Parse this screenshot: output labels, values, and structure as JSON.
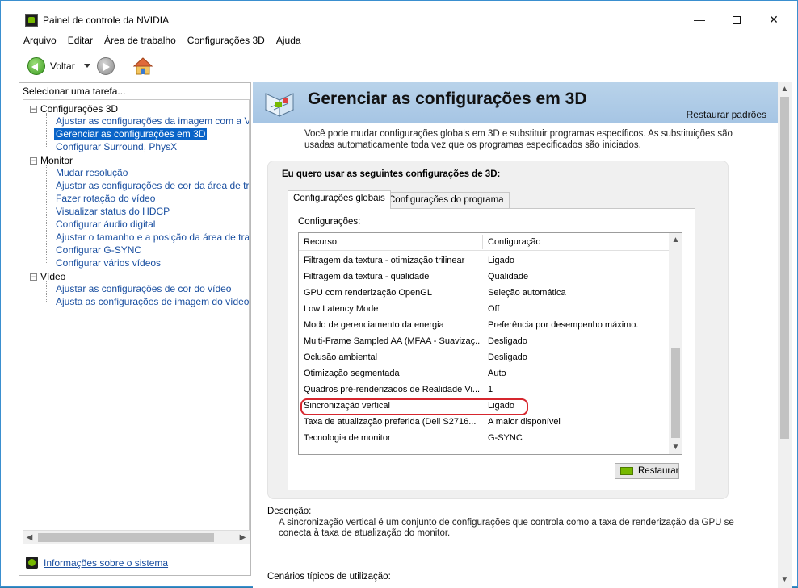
{
  "window": {
    "title": "Painel de controle da NVIDIA",
    "minimize_glyph": "—",
    "close_glyph": "✕"
  },
  "menu": [
    "Arquivo",
    "Editar",
    "Área de trabalho",
    "Configurações 3D",
    "Ajuda"
  ],
  "toolbar": {
    "back_label": "Voltar"
  },
  "left": {
    "header": "Selecionar uma tarefa...",
    "groups": [
      {
        "label": "Configurações 3D",
        "expander": "−",
        "items": [
          "Ajustar as configurações da imagem com a Visuali:",
          "Gerenciar as configurações em 3D",
          "Configurar Surround, PhysX"
        ]
      },
      {
        "label": "Monitor",
        "expander": "−",
        "items": [
          "Mudar resolução",
          "Ajustar as configurações de cor da área de trabal",
          "Fazer rotação do vídeo",
          "Visualizar status do HDCP",
          "Configurar áudio digital",
          "Ajustar o tamanho e a posição da área de trabalh",
          "Configurar G-SYNC",
          "Configurar vários vídeos"
        ]
      },
      {
        "label": "Vídeo",
        "expander": "−",
        "items": [
          "Ajustar as configurações de cor do vídeo",
          "Ajusta as configurações de imagem do vídeo"
        ]
      }
    ],
    "selected_item": "Gerenciar as configurações em 3D",
    "system_info": "Informações sobre o sistema"
  },
  "main": {
    "title": "Gerenciar as configurações em 3D",
    "restore_defaults": "Restaurar padrões",
    "intro": "Você pode mudar configurações globais em 3D e substituir programas específicos. As substituições são usadas automaticamente toda vez que os programas especificados são iniciados.",
    "group_title": "Eu quero usar as seguintes configurações de 3D:",
    "tabs": [
      "Configurações globais",
      "Configurações do programa"
    ],
    "active_tab": "Configurações globais",
    "settings_label": "Configurações:",
    "columns": [
      "Recurso",
      "Configuração"
    ],
    "rows": [
      [
        "Filtragem da textura - otimização trilinear",
        "Ligado"
      ],
      [
        "Filtragem da textura - qualidade",
        "Qualidade"
      ],
      [
        "GPU com renderização OpenGL",
        "Seleção automática"
      ],
      [
        "Low Latency Mode",
        "Off"
      ],
      [
        "Modo de gerenciamento da energia",
        "Preferência por desempenho máximo."
      ],
      [
        "Multi-Frame Sampled AA (MFAA - Suavizaç...",
        "Desligado"
      ],
      [
        "Oclusão ambiental",
        "Desligado"
      ],
      [
        "Otimização segmentada",
        "Auto"
      ],
      [
        "Quadros pré-renderizados de Realidade Vi...",
        "1"
      ],
      [
        "Sincronização vertical",
        "Ligado"
      ],
      [
        "Taxa de atualização preferida (Dell S2716...",
        "A maior disponível"
      ],
      [
        "Tecnologia de monitor",
        "G-SYNC"
      ]
    ],
    "highlighted_row": "Sincronização vertical",
    "restore_button": "Restaurar",
    "description_label": "Descrição:",
    "description": "A sincronização vertical é um conjunto de configurações que controla como a taxa de renderização da GPU se conecta à taxa de atualização do monitor.",
    "scenarios_label": "Cenários típicos de utilização:"
  },
  "colors": {
    "accent_selection": "#0a64c8",
    "link": "#1a4fa0",
    "nvidia_green": "#76b900",
    "highlight_oval": "#d6262e"
  }
}
